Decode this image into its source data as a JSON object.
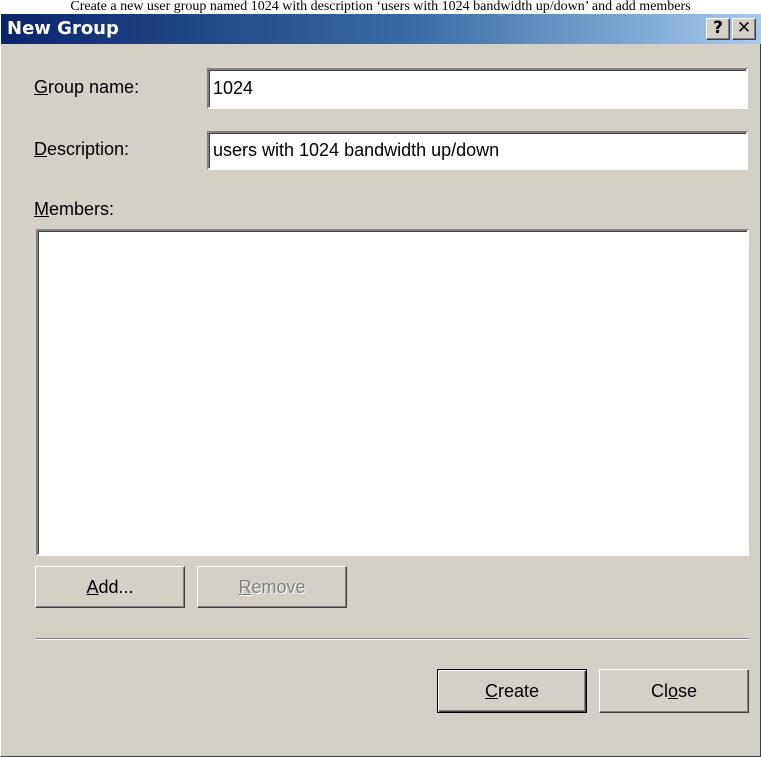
{
  "caption": "Create a new user group named 1024 with description ‘users with 1024 bandwidth up/down’ and add members",
  "window": {
    "title": "New Group",
    "help_label": "?",
    "close_label": "✕"
  },
  "form": {
    "group_name": {
      "label_mnemonic": "G",
      "label_rest": "roup name:",
      "value": "1024"
    },
    "description": {
      "label_mnemonic": "D",
      "label_rest": "escription:",
      "value": "users with 1024 bandwidth up/down"
    },
    "members": {
      "label_mnemonic": "M",
      "label_rest": "embers:",
      "items": []
    }
  },
  "buttons": {
    "add": {
      "mnemonic": "A",
      "rest": "dd..."
    },
    "remove": {
      "mnemonic": "R",
      "rest": "emove",
      "disabled": true
    },
    "create": {
      "mnemonic": "C",
      "rest": "reate"
    },
    "close": {
      "pre": "Cl",
      "mnemonic": "o",
      "rest": "se"
    }
  }
}
